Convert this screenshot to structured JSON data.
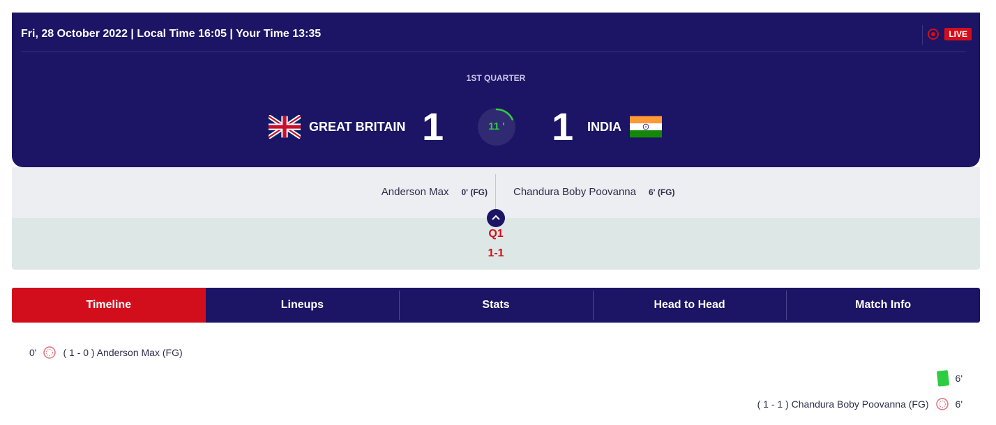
{
  "header": {
    "datetime": "Fri, 28 October 2022 | Local Time 16:05 | Your Time 13:35",
    "live_label": "LIVE",
    "period_status": "1ST QUARTER",
    "clock": "11 '",
    "clock_progress": 0.18
  },
  "home": {
    "name": "GREAT BRITAIN",
    "score": "1",
    "flag": "gb-flag-icon"
  },
  "away": {
    "name": "INDIA",
    "score": "1",
    "flag": "india-flag-icon"
  },
  "scorers": {
    "home": {
      "name": "Anderson Max",
      "time": "0' (FG)"
    },
    "away": {
      "name": "Chandura Boby Poovanna",
      "time": "6' (FG)"
    }
  },
  "period": {
    "label": "Q1",
    "score": "1-1"
  },
  "tabs": [
    "Timeline",
    "Lineups",
    "Stats",
    "Head to Head",
    "Match Info"
  ],
  "active_tab": "Timeline",
  "timeline": [
    {
      "side": "home",
      "minute": "0'",
      "icon": "ball-icon",
      "text": "( 1 - 0 ) Anderson Max (FG)"
    },
    {
      "side": "away",
      "minute": "6'",
      "icon": "green-card-icon",
      "text": ""
    },
    {
      "side": "away",
      "minute": "6'",
      "icon": "ball-icon",
      "text": "( 1 - 1 ) Chandura Boby Poovanna (FG)"
    }
  ],
  "colors": {
    "navy": "#1c1464",
    "red": "#d30e1c",
    "green": "#2ecc40",
    "panel": "#eceef2",
    "period_bg": "#dde8e6"
  }
}
